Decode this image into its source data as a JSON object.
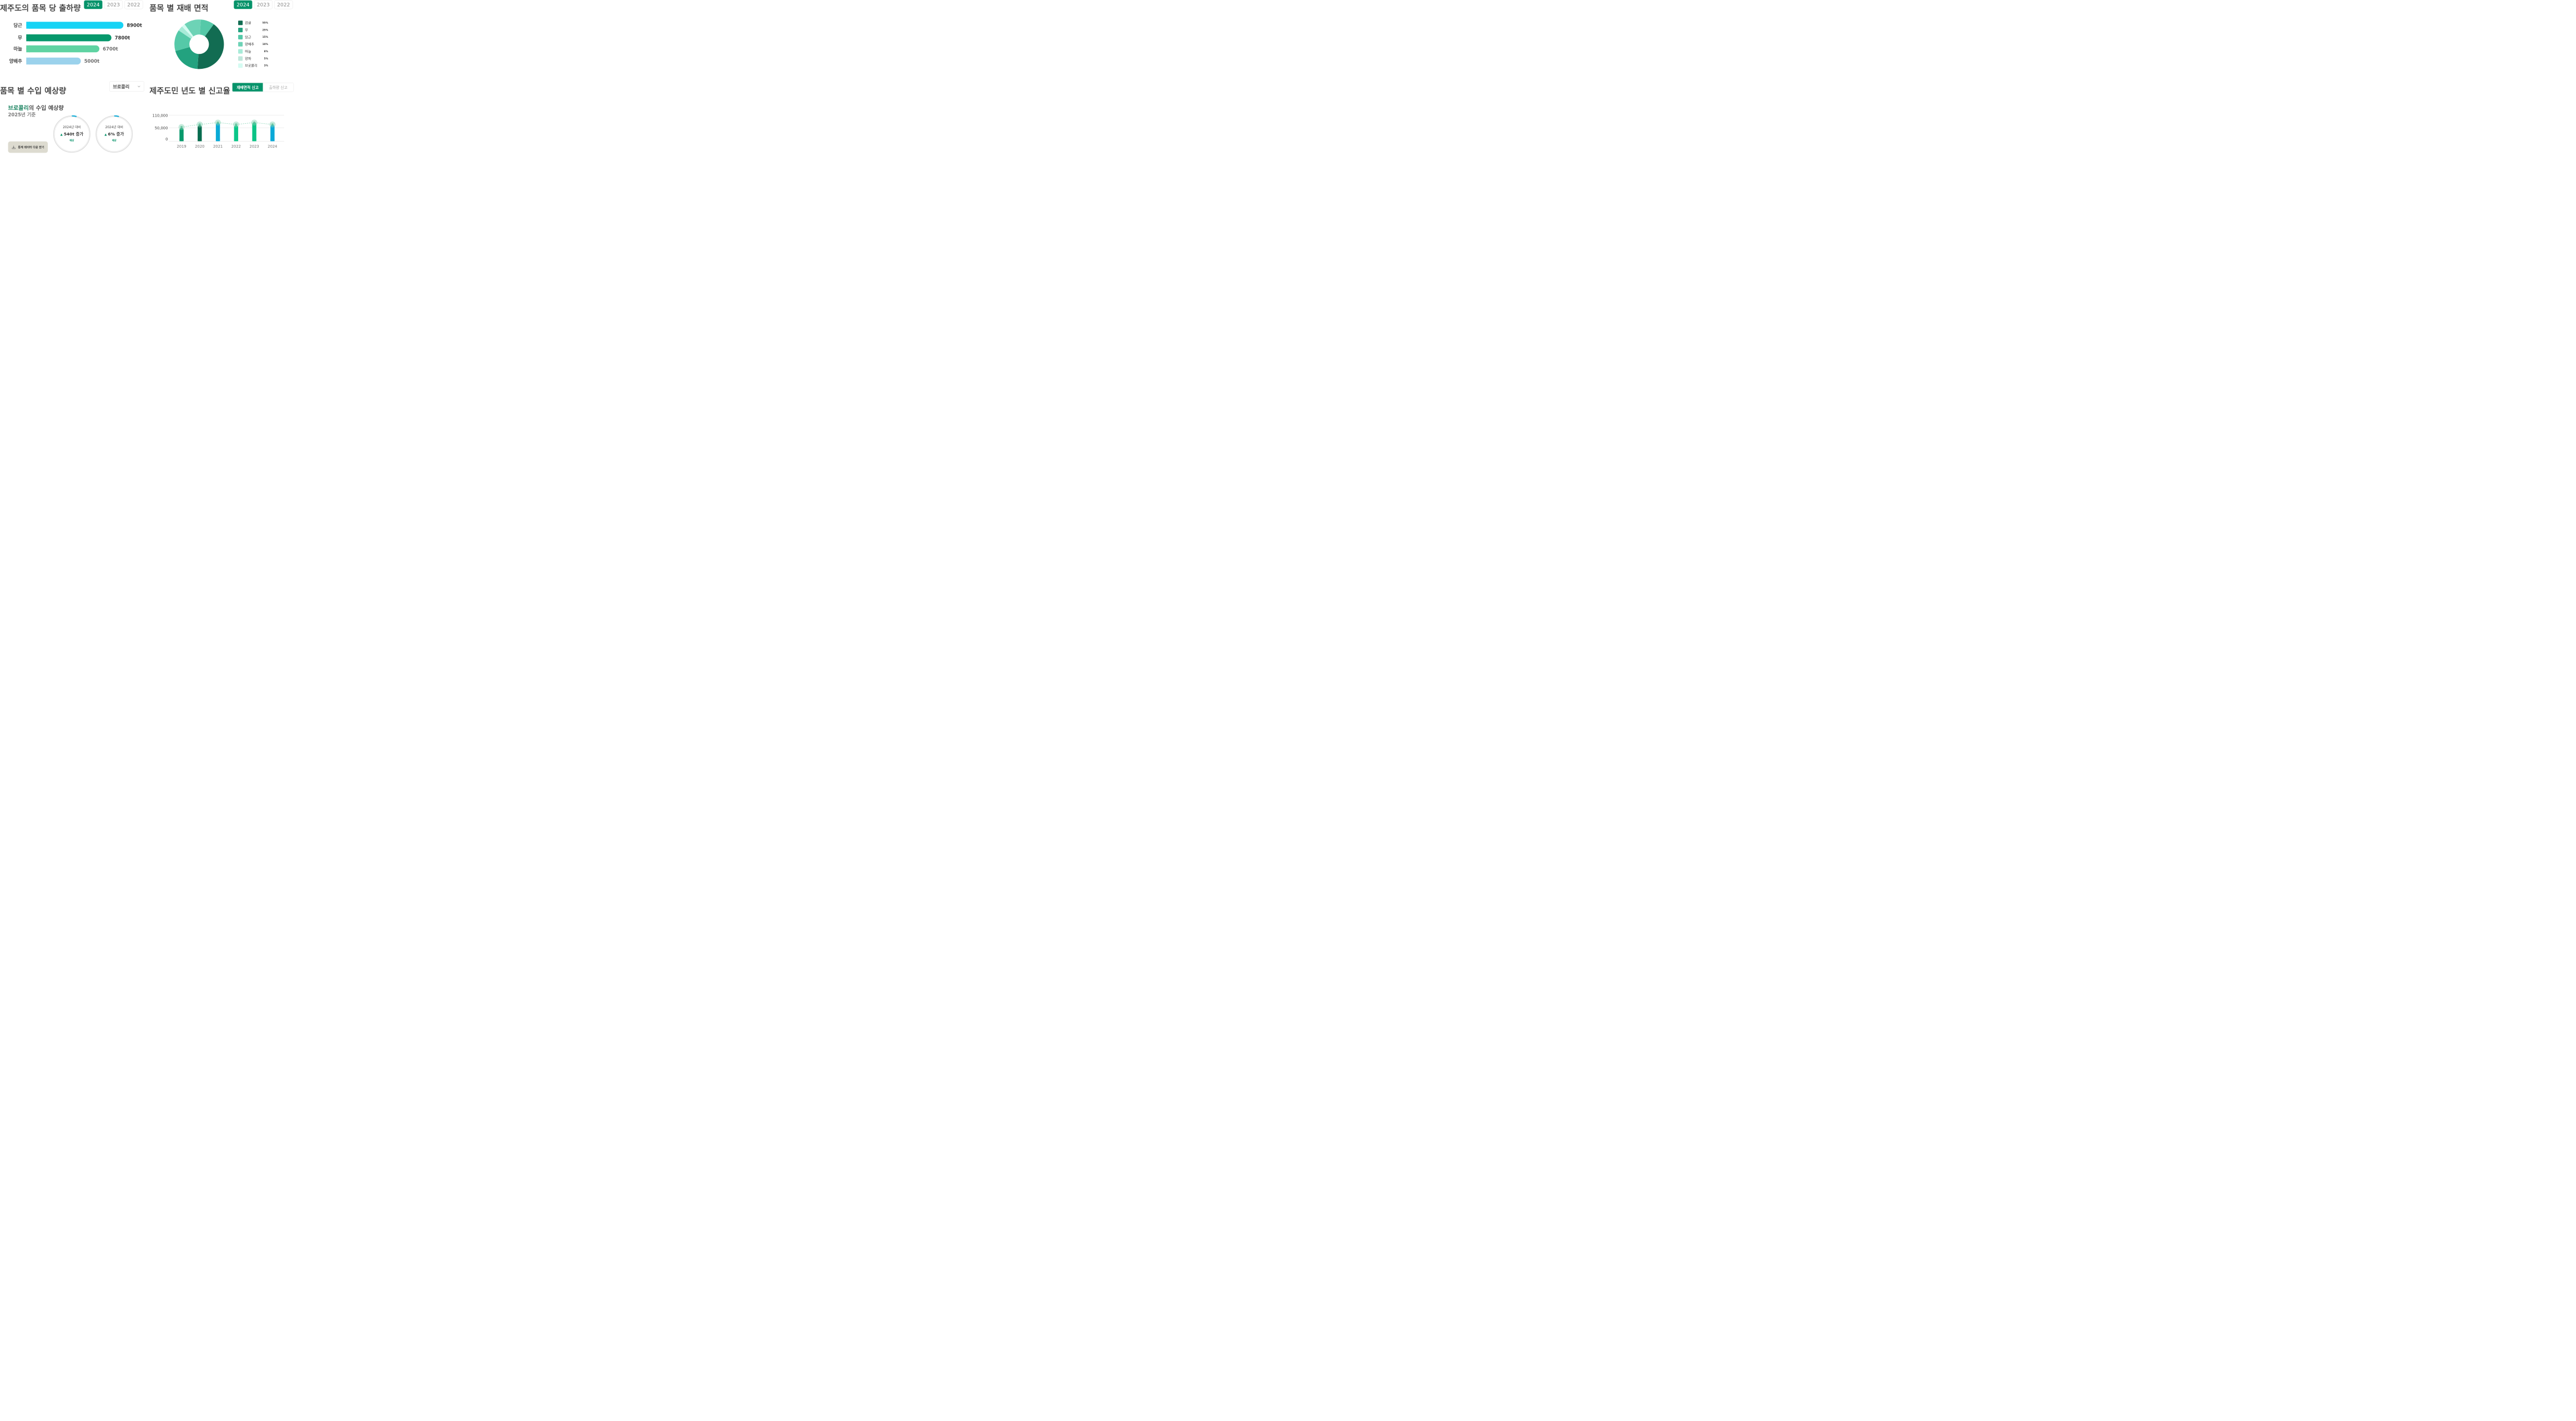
{
  "colors": {
    "accent": "#06936a",
    "accent_dark": "#126c52",
    "teal": "#23a27f",
    "text": "#3f3f3f",
    "muted": "#8a8a8a",
    "blue": "#08a9d6"
  },
  "shipment": {
    "title": "제주도의 품목 당 출하량",
    "years": [
      "2024",
      "2023",
      "2022"
    ],
    "active_year": "2024"
  },
  "area": {
    "title": "품목 별 재배 면적",
    "years": [
      "2024",
      "2023",
      "2022"
    ],
    "active_year": "2024"
  },
  "imports": {
    "title": "품목 별 수입 예상량",
    "select_value": "브로콜리",
    "select_icon": "chevron-down-icon",
    "subtitle_item": "브로콜리",
    "subtitle_suffix": "의 수입 예상량",
    "basis": "2025년 기준",
    "rings": [
      {
        "line1": "2024년 대비",
        "marker": "▲",
        "line2": "540t 증가",
        "line3": "예상"
      },
      {
        "line1": "2024년 대비",
        "marker": "▲",
        "line2": "6% 증가",
        "line3": "예상"
      }
    ],
    "download_label": "통계 데이터 다운 받기",
    "download_icon": "download-icon"
  },
  "report": {
    "title": "제주도민 년도 별 신고율",
    "toggle": [
      "재배면적 신고",
      "출하량 신고"
    ],
    "active_toggle": "재배면적 신고"
  },
  "chart_data": [
    {
      "type": "bar",
      "orientation": "horizontal",
      "categories": [
        "당근",
        "무",
        "마늘",
        "양배추"
      ],
      "values": [
        8900,
        7800,
        6700,
        5000
      ],
      "value_labels": [
        "8900t",
        "7800t",
        "6700t",
        "5000t"
      ],
      "colors": [
        "#17d3f5",
        "#06986c",
        "#5fd3a2",
        "#9bd2ec"
      ]
    },
    {
      "type": "pie",
      "donut": true,
      "labels": [
        "감귤",
        "무",
        "당근",
        "양배추",
        "마늘",
        "양파",
        "브로콜리"
      ],
      "values": [
        55,
        25,
        15,
        10,
        8,
        5,
        3
      ],
      "value_labels": [
        "55%",
        "25%",
        "15%",
        "10%",
        "8%",
        "5%",
        "3%"
      ],
      "colors": [
        "#126c52",
        "#23a27f",
        "#55c9a8",
        "#6dd3b6",
        "#a7ebd8",
        "#bfe7db",
        "#d4fbf1"
      ],
      "legend": "right"
    },
    {
      "type": "bar",
      "with_line": true,
      "categories": [
        "2019",
        "2020",
        "2021",
        "2022",
        "2023",
        "2024"
      ],
      "values": [
        57000,
        68000,
        78000,
        68000,
        80000,
        70000
      ],
      "line_values": [
        57000,
        68000,
        76000,
        68000,
        76000,
        68000
      ],
      "colors": [
        "#07996b",
        "#086c4f",
        "#0aaad6",
        "#0ac688",
        "#0bc385",
        "#0aa9d7"
      ],
      "yticks": [
        "110,000",
        "50,000",
        "0"
      ],
      "ytick_values": [
        110000,
        50000,
        0
      ],
      "ylim": [
        0,
        110000
      ],
      "grid": true
    }
  ]
}
